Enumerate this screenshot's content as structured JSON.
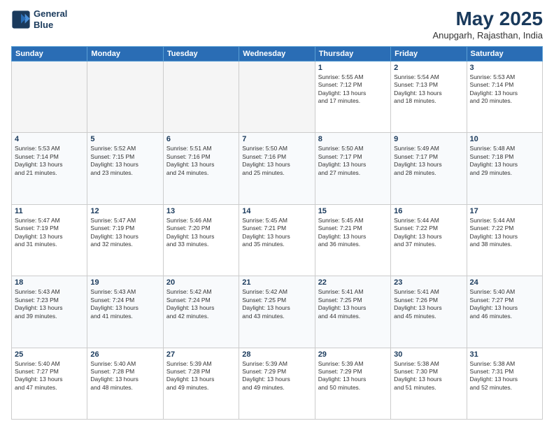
{
  "logo": {
    "line1": "General",
    "line2": "Blue"
  },
  "title": "May 2025",
  "subtitle": "Anupgarh, Rajasthan, India",
  "weekdays": [
    "Sunday",
    "Monday",
    "Tuesday",
    "Wednesday",
    "Thursday",
    "Friday",
    "Saturday"
  ],
  "weeks": [
    [
      {
        "day": "",
        "info": ""
      },
      {
        "day": "",
        "info": ""
      },
      {
        "day": "",
        "info": ""
      },
      {
        "day": "",
        "info": ""
      },
      {
        "day": "1",
        "info": "Sunrise: 5:55 AM\nSunset: 7:12 PM\nDaylight: 13 hours\nand 17 minutes."
      },
      {
        "day": "2",
        "info": "Sunrise: 5:54 AM\nSunset: 7:13 PM\nDaylight: 13 hours\nand 18 minutes."
      },
      {
        "day": "3",
        "info": "Sunrise: 5:53 AM\nSunset: 7:14 PM\nDaylight: 13 hours\nand 20 minutes."
      }
    ],
    [
      {
        "day": "4",
        "info": "Sunrise: 5:53 AM\nSunset: 7:14 PM\nDaylight: 13 hours\nand 21 minutes."
      },
      {
        "day": "5",
        "info": "Sunrise: 5:52 AM\nSunset: 7:15 PM\nDaylight: 13 hours\nand 23 minutes."
      },
      {
        "day": "6",
        "info": "Sunrise: 5:51 AM\nSunset: 7:16 PM\nDaylight: 13 hours\nand 24 minutes."
      },
      {
        "day": "7",
        "info": "Sunrise: 5:50 AM\nSunset: 7:16 PM\nDaylight: 13 hours\nand 25 minutes."
      },
      {
        "day": "8",
        "info": "Sunrise: 5:50 AM\nSunset: 7:17 PM\nDaylight: 13 hours\nand 27 minutes."
      },
      {
        "day": "9",
        "info": "Sunrise: 5:49 AM\nSunset: 7:17 PM\nDaylight: 13 hours\nand 28 minutes."
      },
      {
        "day": "10",
        "info": "Sunrise: 5:48 AM\nSunset: 7:18 PM\nDaylight: 13 hours\nand 29 minutes."
      }
    ],
    [
      {
        "day": "11",
        "info": "Sunrise: 5:47 AM\nSunset: 7:19 PM\nDaylight: 13 hours\nand 31 minutes."
      },
      {
        "day": "12",
        "info": "Sunrise: 5:47 AM\nSunset: 7:19 PM\nDaylight: 13 hours\nand 32 minutes."
      },
      {
        "day": "13",
        "info": "Sunrise: 5:46 AM\nSunset: 7:20 PM\nDaylight: 13 hours\nand 33 minutes."
      },
      {
        "day": "14",
        "info": "Sunrise: 5:45 AM\nSunset: 7:21 PM\nDaylight: 13 hours\nand 35 minutes."
      },
      {
        "day": "15",
        "info": "Sunrise: 5:45 AM\nSunset: 7:21 PM\nDaylight: 13 hours\nand 36 minutes."
      },
      {
        "day": "16",
        "info": "Sunrise: 5:44 AM\nSunset: 7:22 PM\nDaylight: 13 hours\nand 37 minutes."
      },
      {
        "day": "17",
        "info": "Sunrise: 5:44 AM\nSunset: 7:22 PM\nDaylight: 13 hours\nand 38 minutes."
      }
    ],
    [
      {
        "day": "18",
        "info": "Sunrise: 5:43 AM\nSunset: 7:23 PM\nDaylight: 13 hours\nand 39 minutes."
      },
      {
        "day": "19",
        "info": "Sunrise: 5:43 AM\nSunset: 7:24 PM\nDaylight: 13 hours\nand 41 minutes."
      },
      {
        "day": "20",
        "info": "Sunrise: 5:42 AM\nSunset: 7:24 PM\nDaylight: 13 hours\nand 42 minutes."
      },
      {
        "day": "21",
        "info": "Sunrise: 5:42 AM\nSunset: 7:25 PM\nDaylight: 13 hours\nand 43 minutes."
      },
      {
        "day": "22",
        "info": "Sunrise: 5:41 AM\nSunset: 7:25 PM\nDaylight: 13 hours\nand 44 minutes."
      },
      {
        "day": "23",
        "info": "Sunrise: 5:41 AM\nSunset: 7:26 PM\nDaylight: 13 hours\nand 45 minutes."
      },
      {
        "day": "24",
        "info": "Sunrise: 5:40 AM\nSunset: 7:27 PM\nDaylight: 13 hours\nand 46 minutes."
      }
    ],
    [
      {
        "day": "25",
        "info": "Sunrise: 5:40 AM\nSunset: 7:27 PM\nDaylight: 13 hours\nand 47 minutes."
      },
      {
        "day": "26",
        "info": "Sunrise: 5:40 AM\nSunset: 7:28 PM\nDaylight: 13 hours\nand 48 minutes."
      },
      {
        "day": "27",
        "info": "Sunrise: 5:39 AM\nSunset: 7:28 PM\nDaylight: 13 hours\nand 49 minutes."
      },
      {
        "day": "28",
        "info": "Sunrise: 5:39 AM\nSunset: 7:29 PM\nDaylight: 13 hours\nand 49 minutes."
      },
      {
        "day": "29",
        "info": "Sunrise: 5:39 AM\nSunset: 7:29 PM\nDaylight: 13 hours\nand 50 minutes."
      },
      {
        "day": "30",
        "info": "Sunrise: 5:38 AM\nSunset: 7:30 PM\nDaylight: 13 hours\nand 51 minutes."
      },
      {
        "day": "31",
        "info": "Sunrise: 5:38 AM\nSunset: 7:31 PM\nDaylight: 13 hours\nand 52 minutes."
      }
    ]
  ]
}
